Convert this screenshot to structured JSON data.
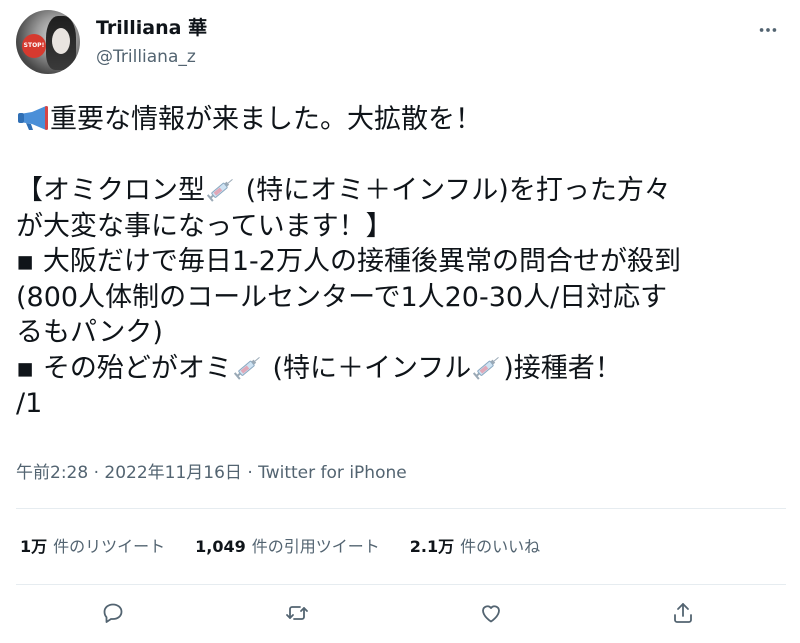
{
  "colors": {
    "text_primary": "#0f1419",
    "text_secondary": "#536471",
    "divider": "#e6ecf0",
    "icon": "#536471",
    "megaphone": "#4a8fd8"
  },
  "user": {
    "display_name": "Trilliana 華",
    "handle": "@Trilliana_z",
    "avatar_badge_text": "STOP!"
  },
  "tweet": {
    "lines": [
      {
        "emoji": "megaphone",
        "text": "重要な情報が来ました。大拡散を！"
      },
      {
        "text": ""
      },
      {
        "text_before": "【オミクロン型",
        "emoji": "syringe",
        "text_after": " (特にオミ＋インフル)を打った方々"
      },
      {
        "text": "が大変な事になっています！】"
      },
      {
        "text": "▪ 大阪だけで毎日1-2万人の接種後異常の問合せが殺到"
      },
      {
        "text": "(800人体制のコールセンターで1人20-30人/日対応す"
      },
      {
        "text": "るもパンク)"
      },
      {
        "text_before": "▪ その殆どがオミ",
        "emoji": "syringe",
        "text_middle": " (特に＋インフル",
        "emoji2": "syringe",
        "text_after": ")接種者！"
      },
      {
        "text": "/1"
      }
    ]
  },
  "meta": {
    "time": "午前2:28",
    "separator1": " · ",
    "date": "2022年11月16日",
    "separator2": " · ",
    "source": "Twitter for iPhone"
  },
  "stats": {
    "retweets": {
      "num": "1万",
      "label": "件のリツイート"
    },
    "quotes": {
      "num": "1,049",
      "label": "件の引用ツイート"
    },
    "likes": {
      "num": "2.1万",
      "label": "件のいいね"
    }
  },
  "icons": {
    "more": "more-icon",
    "reply": "reply-icon",
    "retweet": "retweet-icon",
    "like": "heart-icon",
    "share": "share-icon"
  }
}
